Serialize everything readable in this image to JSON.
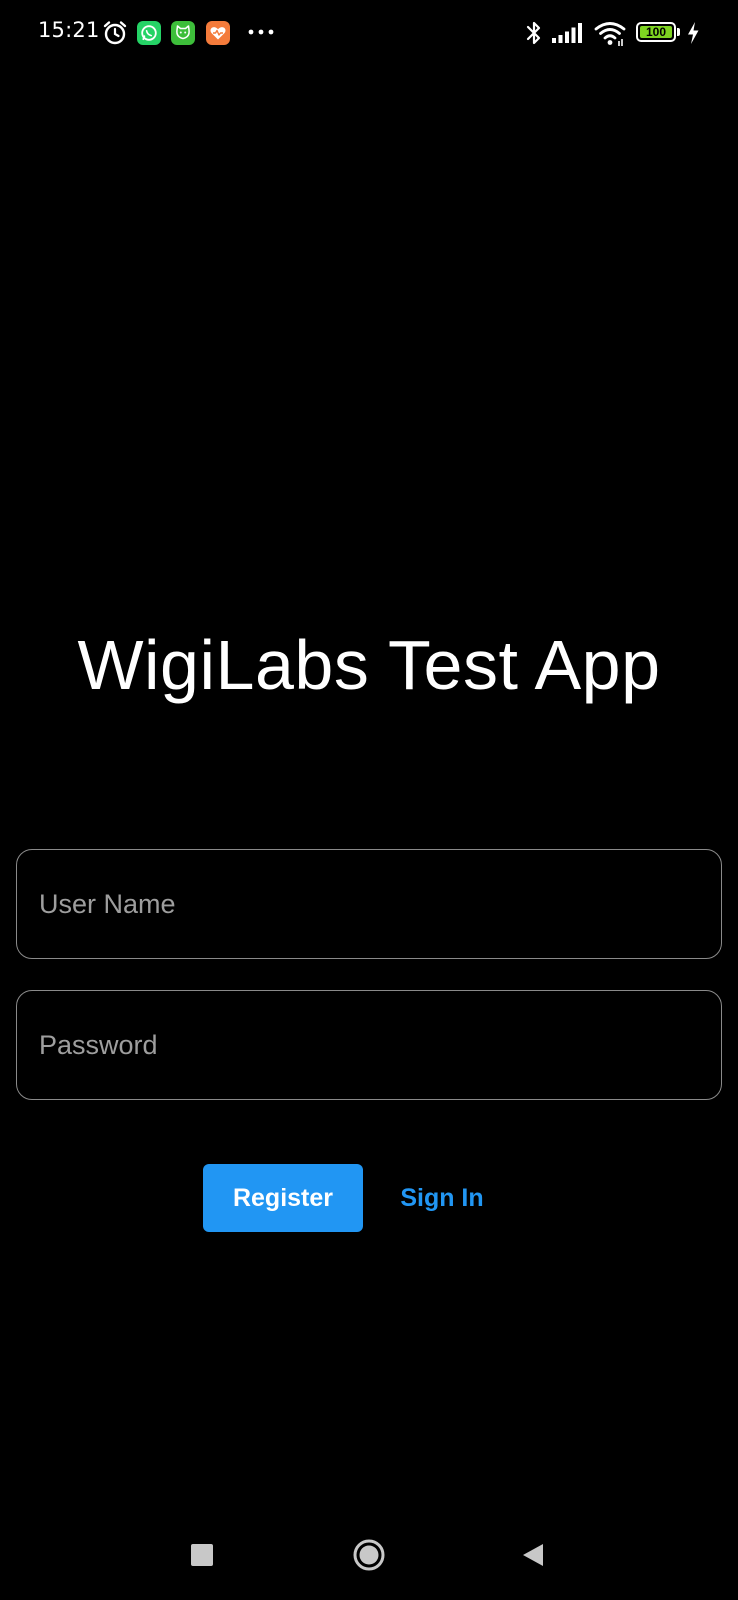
{
  "status_bar": {
    "time": "15:21",
    "battery_level": "100",
    "battery_color": "#7ED321",
    "left_icons": [
      "alarm-icon",
      "whatsapp-icon",
      "cat-app-icon",
      "health-app-icon",
      "more-notifications-icon"
    ],
    "right_icons": [
      "bluetooth-icon",
      "cellular-signal-icon",
      "wifi-icon",
      "battery-icon",
      "charging-icon"
    ]
  },
  "app": {
    "title": "WigiLabs Test App"
  },
  "form": {
    "username_placeholder": "User Name",
    "password_placeholder": "Password",
    "register_label": "Register",
    "signin_label": "Sign In",
    "accent_color": "#2196F3"
  },
  "nav_bar": {
    "icons": [
      "recents-icon",
      "home-icon",
      "back-icon"
    ]
  }
}
